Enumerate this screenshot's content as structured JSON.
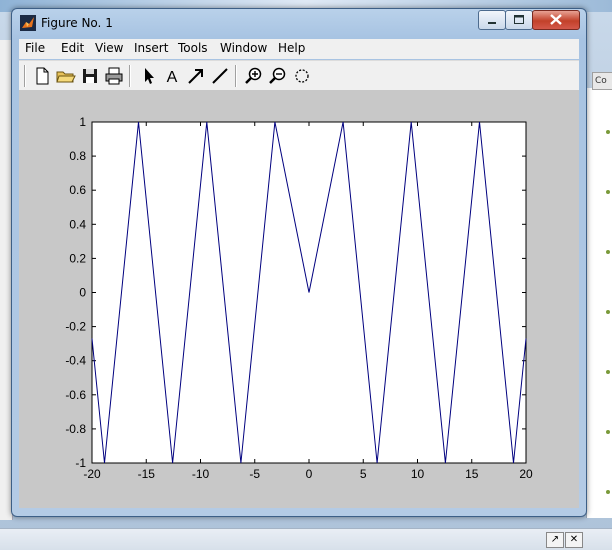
{
  "window": {
    "title": "Figure No. 1"
  },
  "menu": [
    "File",
    "Edit",
    "View",
    "Insert",
    "Tools",
    "Window",
    "Help"
  ],
  "toolbar": [
    "new-file-icon",
    "open-folder-icon",
    "save-icon",
    "print-icon",
    "select-arrow-icon",
    "insert-text-icon",
    "insert-arrow-icon",
    "insert-line-icon",
    "zoom-in-icon",
    "zoom-out-icon",
    "rotate-3d-icon"
  ],
  "background": {
    "panel_tab": "Co"
  },
  "colors": {
    "line": "#00007f",
    "figure_bg": "#c8c8c8",
    "axes_bg": "#ffffff"
  },
  "chart_data": {
    "type": "line",
    "title": "",
    "xlabel": "",
    "ylabel": "",
    "xlim": [
      -20,
      20
    ],
    "ylim": [
      -1,
      1
    ],
    "xticks": [
      "-20",
      "-15",
      "-10",
      "-5",
      "0",
      "5",
      "10",
      "15",
      "20"
    ],
    "yticks": [
      "1",
      "0.8",
      "0.6",
      "0.4",
      "0.2",
      "0",
      "-0.2",
      "-0.4",
      "-0.6",
      "-0.8",
      "-1"
    ],
    "grid": false,
    "series": [
      {
        "x": [
          -20,
          -18.85,
          -15.71,
          -12.57,
          -9.42,
          -6.28,
          -3.14,
          0,
          3.14,
          6.28,
          9.42,
          12.57,
          15.71,
          18.85,
          20
        ],
        "y": [
          -0.27,
          -1,
          1,
          -1,
          1,
          -1,
          1,
          0,
          1,
          -1,
          1,
          -1,
          1,
          -1,
          -0.27
        ]
      }
    ]
  }
}
